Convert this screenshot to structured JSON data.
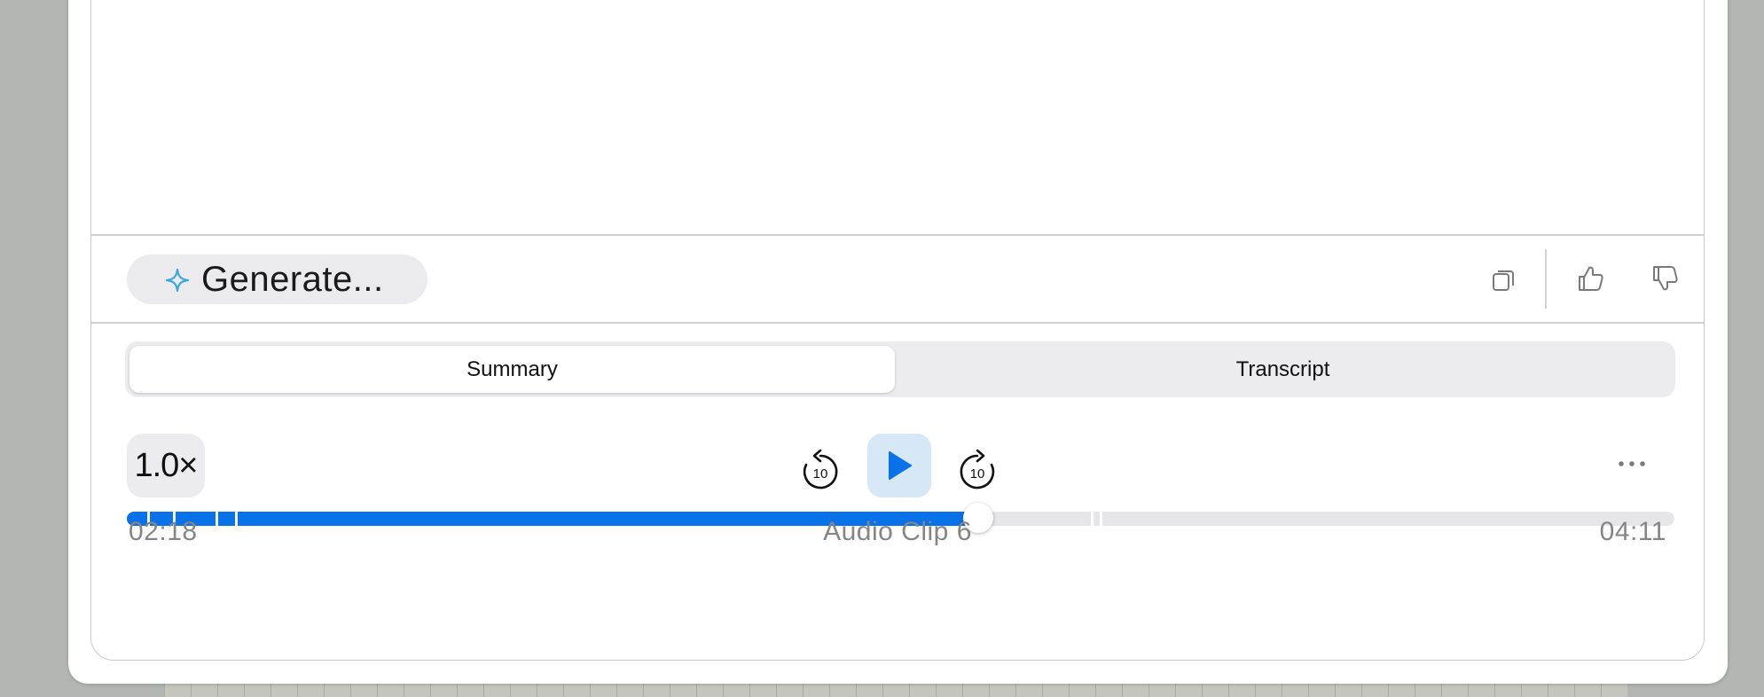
{
  "toolbar": {
    "generate_label": "Generate...",
    "icons": [
      "sparkle-icon",
      "copy-icon",
      "thumbs-up-icon",
      "thumbs-down-icon"
    ]
  },
  "tabs": [
    {
      "label": "Summary",
      "selected": true
    },
    {
      "label": "Transcript",
      "selected": false
    }
  ],
  "player": {
    "speed": "1.0×",
    "elapsed": "02:18",
    "duration": "04:11",
    "clip_title": "Audio Clip 6",
    "progress": 0.55,
    "state": "paused",
    "icons": [
      "skip-back-10-icon",
      "play-icon",
      "skip-forward-10-icon",
      "more-icon"
    ]
  },
  "colors": {
    "accent": "#0a72e8",
    "play_button_bg": "#d6e7f6",
    "sparkle": "#3aa6e0"
  }
}
